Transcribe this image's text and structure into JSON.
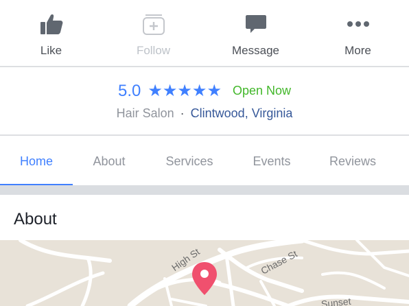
{
  "actions": {
    "like": "Like",
    "follow": "Follow",
    "message": "Message",
    "more": "More"
  },
  "rating": {
    "score": "5.0",
    "stars": "★★★★★",
    "status": "Open Now"
  },
  "business": {
    "category": "Hair Salon",
    "separator": "·",
    "location": "Clintwood, Virginia"
  },
  "tabs": [
    "Home",
    "About",
    "Services",
    "Events",
    "Reviews"
  ],
  "active_tab": "Home",
  "section": {
    "title": "About"
  },
  "map": {
    "streets": [
      "High St",
      "Chase St",
      "Sunset"
    ]
  },
  "colors": {
    "accent": "#4080ff",
    "open": "#42b72a",
    "link": "#365899",
    "pin": "#f0506e"
  }
}
